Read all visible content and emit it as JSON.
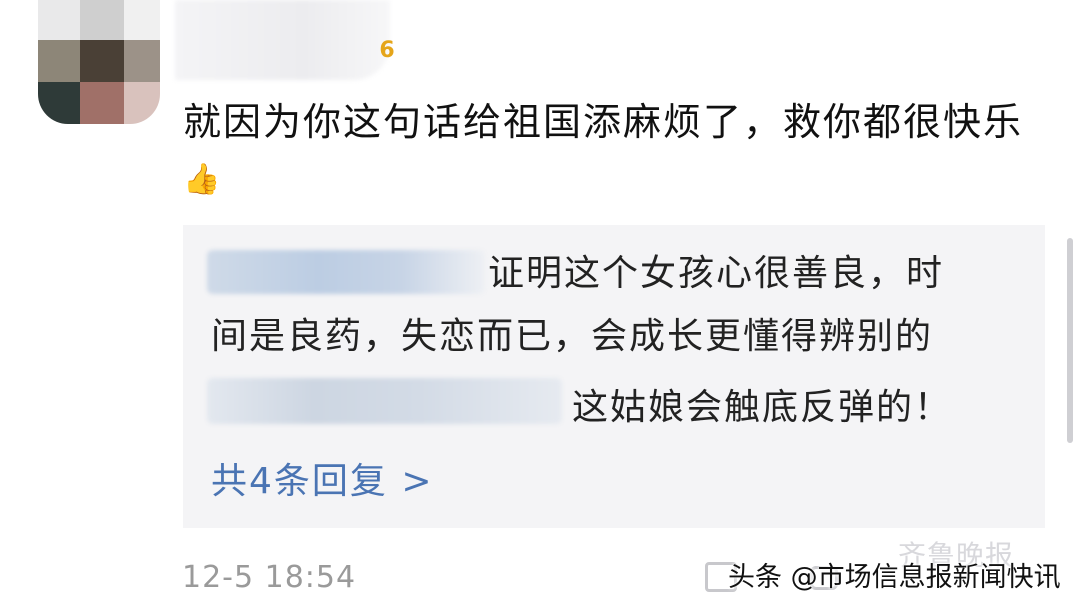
{
  "comment": {
    "text": "就因为你这句话给祖国添麻烦了，救你都很快乐",
    "thumb_icon": "thumbs-up-emoji",
    "vip_badge": "6",
    "timestamp": "12-5 18:54"
  },
  "replies": {
    "items": [
      {
        "text_line1": "证明这个女孩心很善良，时",
        "text_line2": "间是良药，失恋而已，会成长更懂得辨别的"
      },
      {
        "text_line1": "这姑娘会触底反弹的！"
      }
    ],
    "more_label": "共4条回复 >"
  },
  "watermarks": {
    "faint": "齐鲁晚报",
    "source": "头条 @市场信息报新闻快讯"
  },
  "colors": {
    "link": "#4a74b3",
    "reply_bg": "#f4f4f6",
    "timestamp": "#9a9a9a"
  }
}
